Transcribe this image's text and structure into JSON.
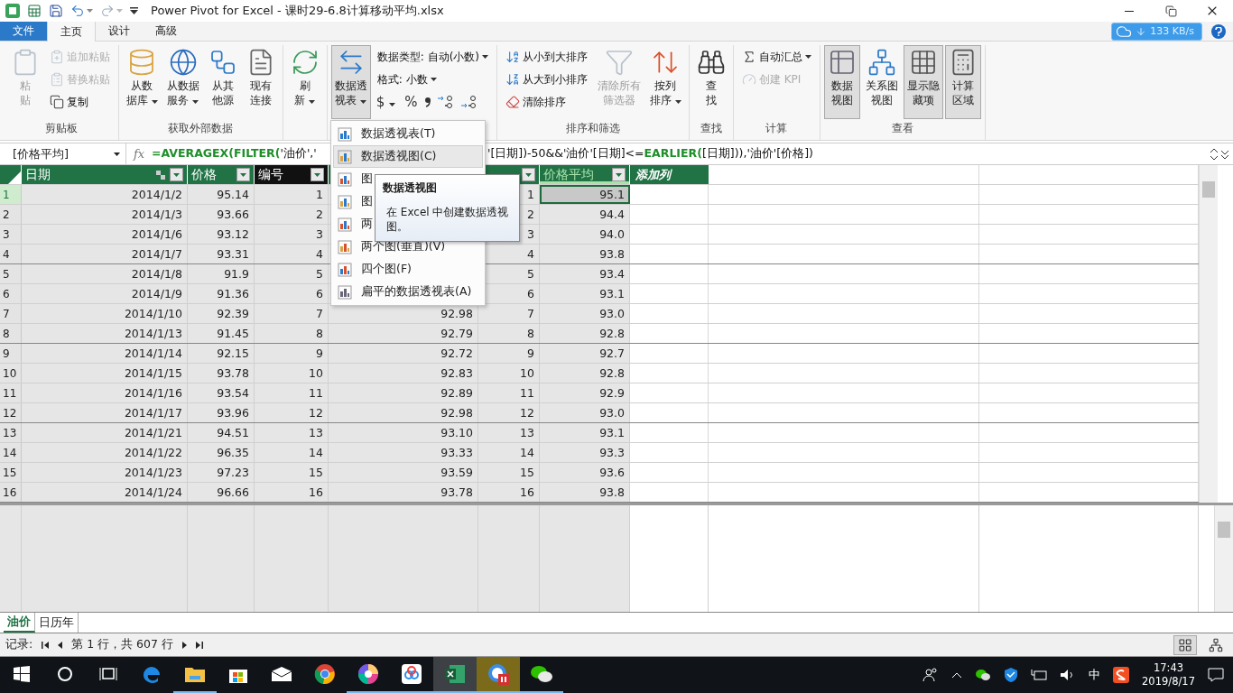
{
  "window": {
    "title": "Power Pivot for Excel - 课时29-6.8计算移动平均.xlsx"
  },
  "ribbon_tabs": [
    {
      "label": "文件",
      "kind": "file",
      "selected": false
    },
    {
      "label": "主页",
      "kind": "tab",
      "selected": true
    },
    {
      "label": "设计",
      "kind": "tab",
      "selected": false
    },
    {
      "label": "高级",
      "kind": "tab",
      "selected": false
    }
  ],
  "speed_badge": {
    "text": "133 KB/s"
  },
  "ribbon_groups": [
    {
      "label": "剪贴板",
      "columns": [
        {
          "kind": "large",
          "lines": [
            "粘",
            "贴"
          ],
          "dropdown": false,
          "disabled": true,
          "selected": false
        },
        {
          "kind": "stack",
          "items": [
            {
              "kind": "text",
              "label": "追加粘贴",
              "dropdown": false,
              "disabled": true
            },
            {
              "kind": "text",
              "label": "替换粘贴",
              "dropdown": false,
              "disabled": true
            },
            {
              "kind": "text",
              "label": "复制",
              "dropdown": false,
              "disabled": false
            }
          ]
        }
      ]
    },
    {
      "label": "获取外部数据",
      "columns": [
        {
          "kind": "large",
          "lines": [
            "从数",
            "据库"
          ],
          "dropdown": true,
          "disabled": false,
          "selected": false
        },
        {
          "kind": "large",
          "lines": [
            "从数据",
            "服务"
          ],
          "dropdown": true,
          "disabled": false,
          "selected": false
        },
        {
          "kind": "large",
          "lines": [
            "从其",
            "他源"
          ],
          "dropdown": false,
          "disabled": false,
          "selected": false
        },
        {
          "kind": "large",
          "lines": [
            "现有",
            "连接"
          ],
          "dropdown": false,
          "disabled": false,
          "selected": false
        }
      ]
    },
    {
      "columns": [
        {
          "kind": "large",
          "lines": [
            "刷",
            "新"
          ],
          "dropdown": true,
          "disabled": false,
          "selected": false
        }
      ]
    },
    {
      "columns": [
        {
          "kind": "large",
          "lines": [
            "数据透",
            "视表"
          ],
          "dropdown": true,
          "disabled": false,
          "selected": true
        },
        {
          "kind": "stack",
          "items": [
            {
              "kind": "text",
              "label": "数据类型: 自动(小数)",
              "dropdown": true,
              "disabled": false
            },
            {
              "kind": "text",
              "label": "格式: 小数",
              "dropdown": true,
              "disabled": false
            },
            {
              "kind": "symbols",
              "symbols": [
                "$",
                "%"
              ],
              "dropdown": true
            }
          ]
        }
      ]
    },
    {
      "label": "排序和筛选",
      "columns": [
        {
          "kind": "stack",
          "items": [
            {
              "kind": "text",
              "label": "从小到大排序",
              "dropdown": false,
              "disabled": false
            },
            {
              "kind": "text",
              "label": "从大到小排序",
              "dropdown": false,
              "disabled": false
            },
            {
              "kind": "text",
              "label": "清除排序",
              "dropdown": false,
              "disabled": false
            }
          ]
        },
        {
          "kind": "large",
          "lines": [
            "清除所有",
            "筛选器"
          ],
          "dropdown": false,
          "disabled": true,
          "selected": false
        },
        {
          "kind": "large",
          "lines": [
            "按列",
            "排序"
          ],
          "dropdown": true,
          "disabled": false,
          "selected": false
        }
      ]
    },
    {
      "label": "查找",
      "columns": [
        {
          "kind": "large",
          "lines": [
            "查",
            "找"
          ],
          "dropdown": false,
          "disabled": false,
          "selected": false
        }
      ]
    },
    {
      "label": "计算",
      "columns": [
        {
          "kind": "stack",
          "items": [
            {
              "kind": "text",
              "label": "自动汇总",
              "dropdown": true,
              "disabled": false
            },
            {
              "kind": "text",
              "label": "创建 KPI",
              "dropdown": false,
              "disabled": true
            }
          ]
        }
      ]
    },
    {
      "label": "查看",
      "columns": [
        {
          "kind": "large",
          "lines": [
            "数据",
            "视图"
          ],
          "dropdown": false,
          "disabled": false,
          "selected": true
        },
        {
          "kind": "large",
          "lines": [
            "关系图",
            "视图"
          ],
          "dropdown": false,
          "disabled": false,
          "selected": false
        },
        {
          "kind": "large",
          "lines": [
            "显示隐",
            "藏项"
          ],
          "dropdown": false,
          "disabled": false,
          "selected": true
        },
        {
          "kind": "large",
          "lines": [
            "计算",
            "区域"
          ],
          "dropdown": false,
          "disabled": false,
          "selected": true
        }
      ]
    }
  ],
  "formula_bar": {
    "name_box": "[价格平均]",
    "function_label": "fx",
    "start": [
      {
        "kind": "function",
        "text": "=AVERAGEX("
      },
      {
        "kind": "function",
        "text": "FILTER("
      },
      {
        "kind": "text",
        "text": "'油价','"
      }
    ],
    "end": [
      {
        "kind": "text",
        "text": "'[日期])-50&&'油价'[日期]<="
      },
      {
        "kind": "function",
        "text": "EARLIER("
      },
      {
        "kind": "text",
        "text": "[日期])),'油价'[价格])"
      }
    ]
  },
  "table": {
    "columns": [
      {
        "header": "日期",
        "kind": "date",
        "dropdown": true,
        "highlighted": false,
        "selected": false
      },
      {
        "header": "价格",
        "kind": "number",
        "dropdown": true,
        "highlighted": false,
        "selected": false
      },
      {
        "header": "编号",
        "kind": "number",
        "dropdown": true,
        "highlighted": true,
        "selected": false
      },
      {
        "kind": "number"
      },
      {
        "kind": "number",
        "dropdown": true,
        "highlighted": false,
        "selected": false
      },
      {
        "header": "价格平均",
        "kind": "number",
        "dropdown": true,
        "highlighted": false,
        "selected": true
      }
    ],
    "add_column": "添加列",
    "rows": [
      {
        "number": "1",
        "selected": true,
        "cells": [
          "2014/1/2",
          "95.14",
          "1",
          null,
          "1",
          "95.1"
        ]
      },
      {
        "number": "2",
        "selected": false,
        "cells": [
          "2014/1/3",
          "93.66",
          "2",
          null,
          "2",
          "94.4"
        ]
      },
      {
        "number": "3",
        "selected": false,
        "cells": [
          "2014/1/6",
          "93.12",
          "3",
          null,
          "3",
          "94.0"
        ]
      },
      {
        "number": "4",
        "selected": false,
        "cells": [
          "2014/1/7",
          "93.31",
          "4",
          null,
          "4",
          "93.8"
        ]
      },
      {
        "number": "5",
        "selected": false,
        "cells": [
          "2014/1/8",
          "91.9",
          "5",
          null,
          "5",
          "93.4"
        ]
      },
      {
        "number": "6",
        "selected": false,
        "cells": [
          "2014/1/9",
          "91.36",
          "6",
          null,
          "6",
          "93.1"
        ]
      },
      {
        "number": "7",
        "selected": false,
        "cells": [
          "2014/1/10",
          "92.39",
          "7",
          "92.98",
          "7",
          "93.0"
        ]
      },
      {
        "number": "8",
        "selected": false,
        "cells": [
          "2014/1/13",
          "91.45",
          "8",
          "92.79",
          "8",
          "92.8"
        ]
      },
      {
        "number": "9",
        "selected": false,
        "cells": [
          "2014/1/14",
          "92.15",
          "9",
          "92.72",
          "9",
          "92.7"
        ]
      },
      {
        "number": "10",
        "selected": false,
        "cells": [
          "2014/1/15",
          "93.78",
          "10",
          "92.83",
          "10",
          "92.8"
        ]
      },
      {
        "number": "11",
        "selected": false,
        "cells": [
          "2014/1/16",
          "93.54",
          "11",
          "92.89",
          "11",
          "92.9"
        ]
      },
      {
        "number": "12",
        "selected": false,
        "cells": [
          "2014/1/17",
          "93.96",
          "12",
          "92.98",
          "12",
          "93.0"
        ]
      },
      {
        "number": "13",
        "selected": false,
        "cells": [
          "2014/1/21",
          "94.51",
          "13",
          "93.10",
          "13",
          "93.1"
        ]
      },
      {
        "number": "14",
        "selected": false,
        "cells": [
          "2014/1/22",
          "96.35",
          "14",
          "93.33",
          "14",
          "93.3"
        ]
      },
      {
        "number": "15",
        "selected": false,
        "cells": [
          "2014/1/23",
          "97.23",
          "15",
          "93.59",
          "15",
          "93.6"
        ]
      },
      {
        "number": "16",
        "selected": false,
        "cells": [
          "2014/1/24",
          "96.66",
          "16",
          "93.78",
          "16",
          "93.8"
        ]
      }
    ]
  },
  "pivot_menu": {
    "items": [
      {
        "label": "数据透视表(T)",
        "hovered": false
      },
      {
        "label": "数据透视图(C)",
        "hovered": true
      },
      {
        "label": "图",
        "hovered": false
      },
      {
        "label": "图",
        "hovered": false
      },
      {
        "label": "两",
        "hovered": false
      },
      {
        "label": "两个图(垂直)(V)",
        "hovered": false
      },
      {
        "label": "四个图(F)",
        "hovered": false
      },
      {
        "label": "扁平的数据透视表(A)",
        "hovered": false
      }
    ],
    "tooltip": {
      "title": "数据透视图",
      "body": "在 Excel 中创建数据透视图。"
    }
  },
  "sheet_tabs": [
    {
      "label": "油价",
      "selected": true
    },
    {
      "label": "日历年",
      "selected": false
    }
  ],
  "status_bar": {
    "label": "记录:",
    "position": "第 1 行，共 607 行",
    "views": [
      {
        "selected": true
      },
      {
        "selected": false
      }
    ]
  },
  "taskbar": {
    "apps": [
      {
        "running": false,
        "active": false
      },
      {
        "running": true,
        "active": false
      },
      {
        "running": false,
        "active": false
      },
      {
        "running": false,
        "active": false
      },
      {
        "running": false,
        "active": false
      },
      {
        "running": true,
        "active": false
      },
      {
        "running": true,
        "active": false
      },
      {
        "running": true,
        "active": true
      },
      {
        "running": true,
        "active": true
      },
      {
        "running": true,
        "active": false
      }
    ],
    "ime": "中",
    "time": "17:43",
    "date": "2019/8/17"
  }
}
